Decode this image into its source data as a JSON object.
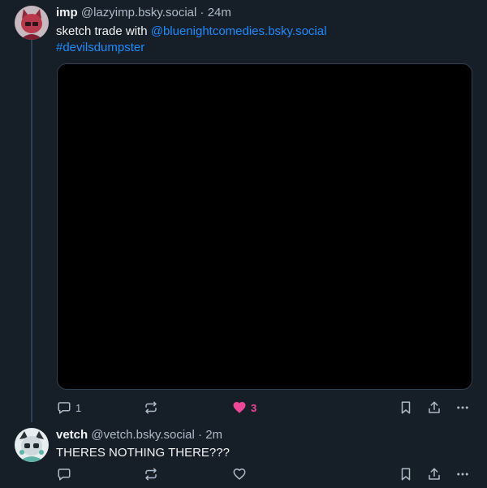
{
  "colors": {
    "background": "#161e27",
    "text": "#f1f3f5",
    "muted": "#aebbc9",
    "link": "#208bfe",
    "like": "#ec4899",
    "thread_line": "#2e4052"
  },
  "posts": [
    {
      "author_name": "imp",
      "author_handle": "@lazyimp.bsky.social",
      "separator": "·",
      "time": "24m",
      "text_prefix": "sketch trade with ",
      "mention": "@bluenightcomedies.bsky.social",
      "hashtag": "#devilsdumpster",
      "avatar_icon": "red-imp-avatar",
      "media": "black-image",
      "reply_count": "1",
      "repost_count": "",
      "like_count": "3",
      "liked": true
    },
    {
      "author_name": "vetch",
      "author_handle": "@vetch.bsky.social",
      "separator": "·",
      "time": "2m",
      "text": "THERES NOTHING THERE???",
      "avatar_icon": "teal-character-avatar",
      "reply_count": "",
      "repost_count": "",
      "like_count": "",
      "liked": false
    }
  ]
}
